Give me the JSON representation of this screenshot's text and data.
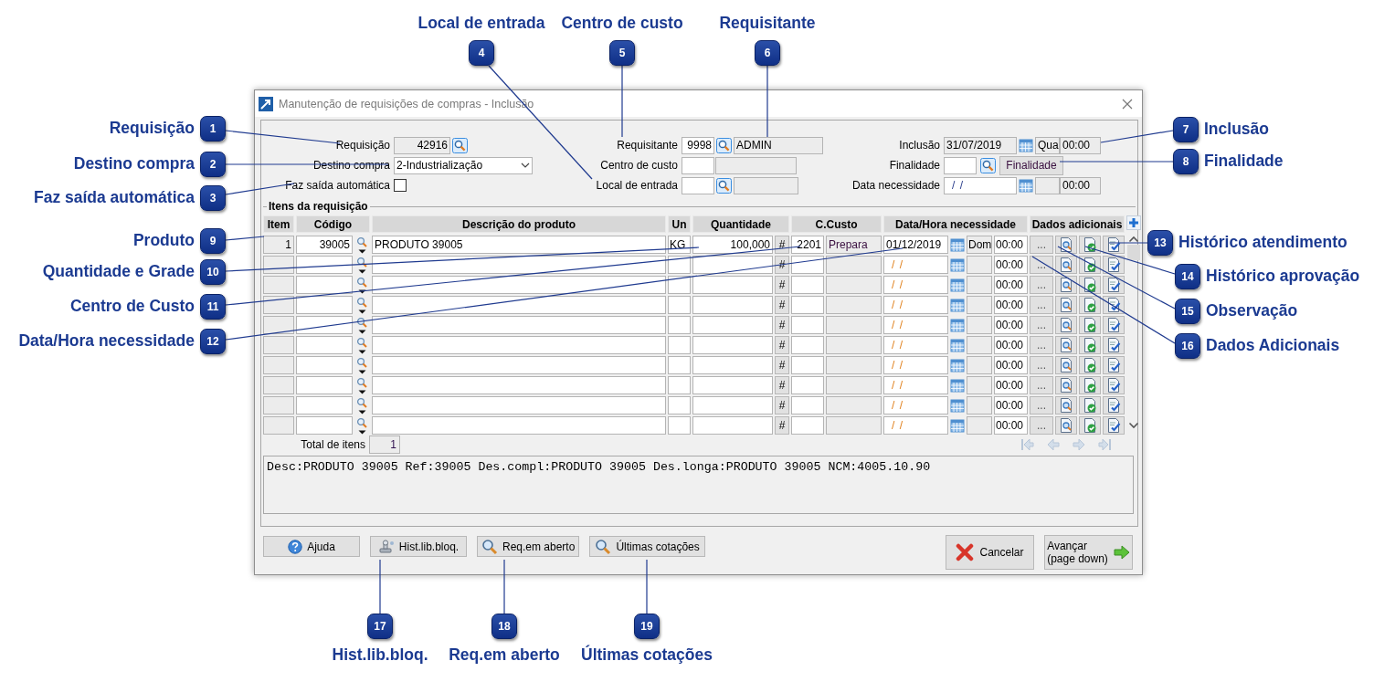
{
  "window": {
    "title": "Manutenção de requisições de compras - Inclusão"
  },
  "left_fields": [
    {
      "kind": "lookup",
      "label": "Requisição",
      "value": "42916"
    },
    {
      "kind": "dropdown",
      "label": "Destino compra",
      "value": "2-Industrialização"
    },
    {
      "kind": "checkbox",
      "label": "Faz saída automática",
      "checked": false
    }
  ],
  "middle_fields": [
    {
      "label": "Requisitante",
      "code": "9998",
      "name": "ADMIN",
      "lookup": true
    },
    {
      "label": "Centro de custo",
      "lookup": false
    },
    {
      "label": "Local de entrada",
      "lookup": true
    }
  ],
  "right_fields": [
    {
      "kind": "date",
      "label": "Inclusão",
      "date": "31/07/2019",
      "weekday": "Qua",
      "time": "00:00",
      "readonly": true
    },
    {
      "kind": "lookup-button",
      "label": "Finalidade",
      "button": "Finalidade"
    },
    {
      "kind": "date",
      "label": "Data necessidade",
      "date_mask": "/ /",
      "time": "00:00",
      "readonly": false
    }
  ],
  "items": {
    "title": "Itens da requisição",
    "columns": [
      "Item",
      "Código",
      "Descrição do produto",
      "Un",
      "Quantidade",
      "C.Custo",
      "Data/Hora necessidade",
      "Dados adicionais"
    ],
    "rows": [
      {
        "item": "1",
        "code": "39005",
        "description": "PRODUTO 39005",
        "unit": "KG",
        "quantity": "100,000",
        "grade_button": "#",
        "cost_center": "2201",
        "cost_center_name": "Prepara",
        "date": "01/12/2019",
        "weekday": "Dom",
        "time": "00:00",
        "more_button": "..."
      },
      {
        "grade_button": "#",
        "date_mask": "/ /",
        "time": "00:00",
        "more_button": "..."
      },
      {
        "grade_button": "#",
        "date_mask": "/ /",
        "time": "00:00",
        "more_button": "..."
      },
      {
        "grade_button": "#",
        "date_mask": "/ /",
        "time": "00:00",
        "more_button": "..."
      },
      {
        "grade_button": "#",
        "date_mask": "/ /",
        "time": "00:00",
        "more_button": "..."
      },
      {
        "grade_button": "#",
        "date_mask": "/ /",
        "time": "00:00",
        "more_button": "..."
      },
      {
        "grade_button": "#",
        "date_mask": "/ /",
        "time": "00:00",
        "more_button": "..."
      },
      {
        "grade_button": "#",
        "date_mask": "/ /",
        "time": "00:00",
        "more_button": "..."
      },
      {
        "grade_button": "#",
        "date_mask": "/ /",
        "time": "00:00",
        "more_button": "..."
      },
      {
        "grade_button": "#",
        "date_mask": "/ /",
        "time": "00:00",
        "more_button": "..."
      }
    ],
    "total_label": "Total de itens",
    "total": "1",
    "memo": "Desc:PRODUTO 39005 Ref:39005 Des.compl:PRODUTO 39005 Des.longa:PRODUTO 39005 NCM:4005.10.90"
  },
  "buttons": [
    {
      "kind": "help",
      "label": "Ajuda"
    },
    {
      "kind": "history",
      "label": "Hist.lib.bloq."
    },
    {
      "kind": "search",
      "label": "Req.em aberto"
    },
    {
      "kind": "search",
      "label": "Últimas cotações"
    }
  ],
  "actions": [
    {
      "kind": "cancel",
      "label": "Cancelar"
    },
    {
      "kind": "next",
      "label": "Avançar",
      "sublabel": "(page down)"
    }
  ],
  "callouts": [
    {
      "number": "1",
      "label": "Requisição"
    },
    {
      "number": "2",
      "label": "Destino compra"
    },
    {
      "number": "3",
      "label": "Faz saída automática"
    },
    {
      "number": "4",
      "label": "Local de entrada"
    },
    {
      "number": "5",
      "label": "Centro de custo"
    },
    {
      "number": "6",
      "label": "Requisitante"
    },
    {
      "number": "7",
      "label": "Inclusão"
    },
    {
      "number": "8",
      "label": "Finalidade"
    },
    {
      "number": "9",
      "label": "Produto"
    },
    {
      "number": "10",
      "label": "Quantidade e Grade"
    },
    {
      "number": "11",
      "label": "Centro de Custo"
    },
    {
      "number": "12",
      "label": "Data/Hora necessidade"
    },
    {
      "number": "13",
      "label": "Histórico atendimento"
    },
    {
      "number": "14",
      "label": "Histórico aprovação"
    },
    {
      "number": "15",
      "label": "Observação"
    },
    {
      "number": "16",
      "label": "Dados Adicionais"
    },
    {
      "number": "17",
      "label": "Hist.lib.bloq."
    },
    {
      "number": "18",
      "label": "Req.em aberto"
    },
    {
      "number": "19",
      "label": "Últimas cotações"
    }
  ]
}
